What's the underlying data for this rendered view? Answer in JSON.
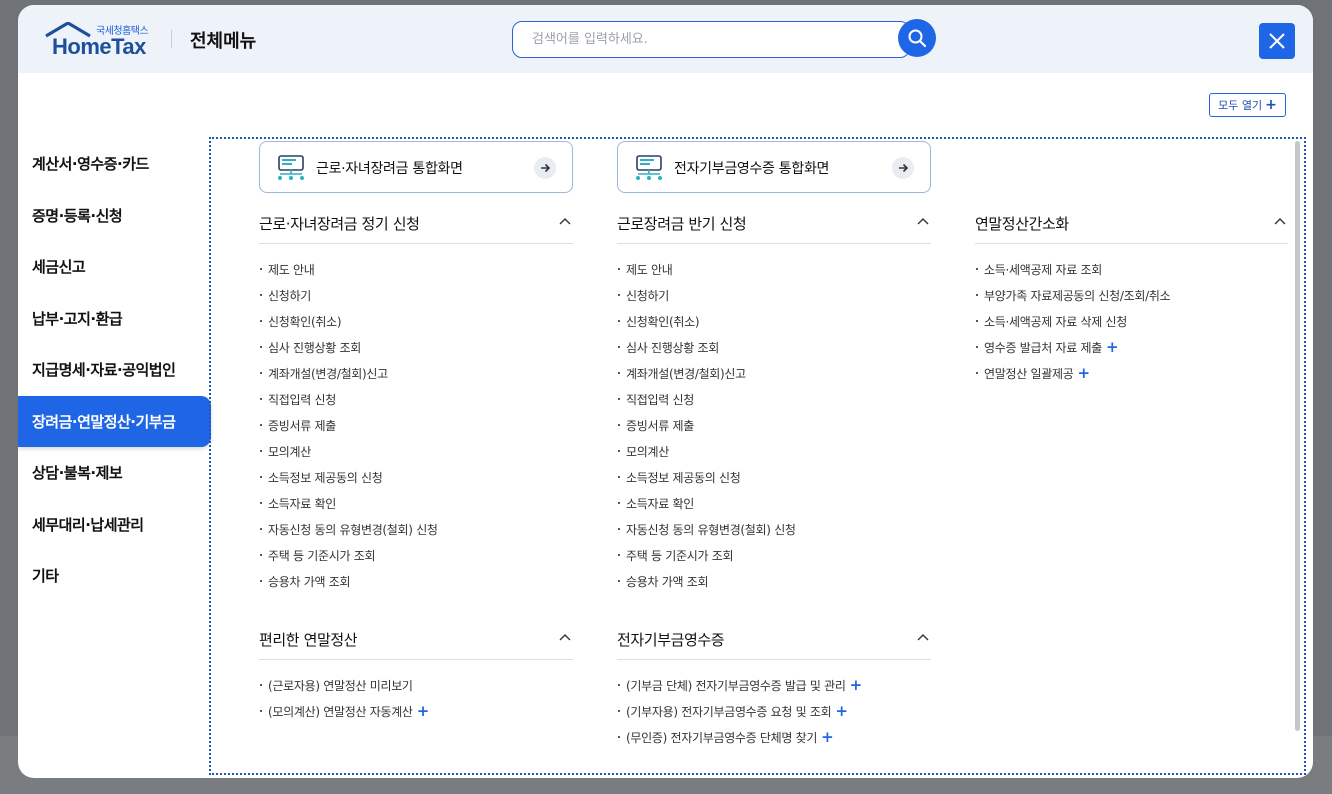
{
  "header": {
    "logo_small": "국세청홈택스",
    "logo_main": "HomeTax",
    "title": "전체메뉴",
    "search_placeholder": "검색어를 입력하세요."
  },
  "expand_all_label": "모두 열기",
  "sidebar": {
    "items": [
      {
        "label": "계산서·영수증·카드"
      },
      {
        "label": "증명·등록·신청"
      },
      {
        "label": "세금신고"
      },
      {
        "label": "납부·고지·환급"
      },
      {
        "label": "지급명세·자료·공익법인"
      },
      {
        "label": "장려금·연말정산·기부금",
        "active": true
      },
      {
        "label": "상담·불복·제보"
      },
      {
        "label": "세무대리·납세관리"
      },
      {
        "label": "기타"
      }
    ]
  },
  "portals": [
    {
      "label": "근로·자녀장려금 통합화면"
    },
    {
      "label": "전자기부금영수증 통합화면"
    }
  ],
  "sections": {
    "col1_a": {
      "title": "근로·자녀장려금 정기 신청",
      "items": [
        "제도 안내",
        "신청하기",
        "신청확인(취소)",
        "심사 진행상황 조회",
        "계좌개설(변경/철회)신고",
        "직접입력 신청",
        "증빙서류 제출",
        "모의계산",
        "소득정보 제공동의 신청",
        "소득자료 확인",
        "자동신청 동의 유형변경(철회) 신청",
        "주택 등 기준시가 조회",
        "승용차 가액 조회"
      ]
    },
    "col1_b": {
      "title": "편리한 연말정산",
      "items": [
        "(근로자용) 연말정산 미리보기",
        "(모의계산) 연말정산 자동계산"
      ]
    },
    "col2_a": {
      "title": "근로장려금 반기 신청",
      "items": [
        "제도 안내",
        "신청하기",
        "신청확인(취소)",
        "심사 진행상황 조회",
        "계좌개설(변경/철회)신고",
        "직접입력 신청",
        "증빙서류 제출",
        "모의계산",
        "소득정보 제공동의 신청",
        "소득자료 확인",
        "자동신청 동의 유형변경(철회) 신청",
        "주택 등 기준시가 조회",
        "승용차 가액 조회"
      ]
    },
    "col2_b": {
      "title": "전자기부금영수증",
      "items": [
        "(기부금 단체) 전자기부금영수증 발급 및 관리",
        "(기부자용) 전자기부금영수증 요청 및 조회",
        "(무인증) 전자기부금영수증 단체명 찾기"
      ]
    },
    "col3_a": {
      "title": "연말정산간소화",
      "items": [
        "소득·세액공제 자료 조회",
        "부양가족 자료제공동의 신청/조회/취소",
        "소득·세액공제 자료 삭제 신청",
        "영수증 발급처 자료 제출",
        "연말정산 일괄제공"
      ]
    }
  },
  "colors": {
    "accent": "#1f66e6",
    "header_bg": "#eef2f9",
    "backdrop": "#6f7276"
  }
}
